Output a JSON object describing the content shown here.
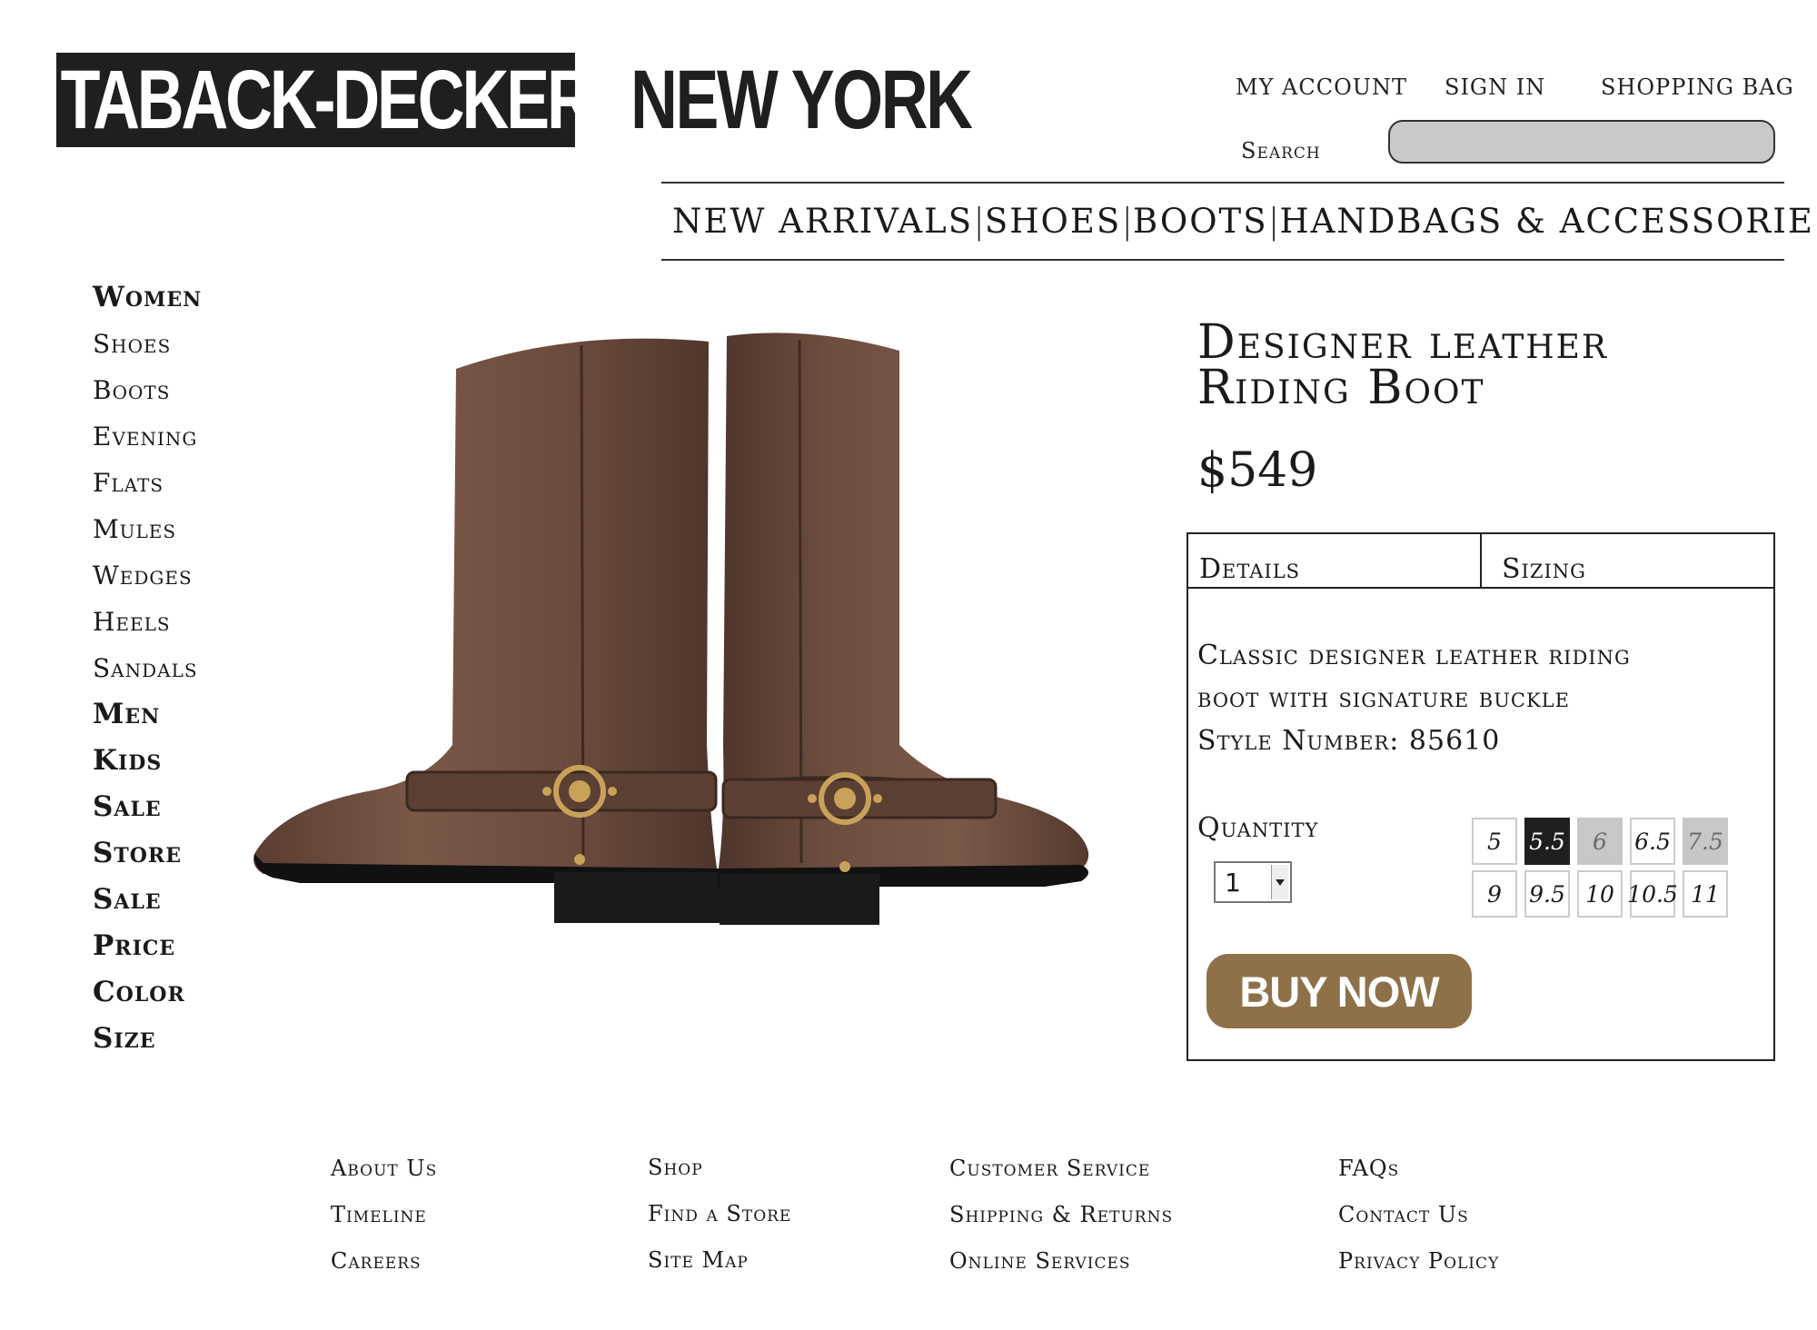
{
  "brand": {
    "logo_dark": "TABACK-DECKER",
    "logo_light": "NEW YORK"
  },
  "header": {
    "my_account": "MY ACCOUNT",
    "sign_in": "SIGN IN",
    "shopping_bag": "SHOPPING BAG",
    "search_label": "Search",
    "search_value": ""
  },
  "nav": {
    "items": [
      "NEW ARRIVALS",
      "SHOES",
      "BOOTS",
      "HANDBAGS & ACCESSORIES"
    ],
    "separator": "|"
  },
  "sidebar": {
    "items": [
      {
        "label": "Women",
        "main": true
      },
      {
        "label": "Shoes",
        "main": false
      },
      {
        "label": "Boots",
        "main": false
      },
      {
        "label": "Evening",
        "main": false
      },
      {
        "label": "Flats",
        "main": false
      },
      {
        "label": "Mules",
        "main": false
      },
      {
        "label": "Wedges",
        "main": false
      },
      {
        "label": "Heels",
        "main": false
      },
      {
        "label": "Sandals",
        "main": false
      },
      {
        "label": "Men",
        "main": true
      },
      {
        "label": "Kids",
        "main": true
      },
      {
        "label": "Sale",
        "main": true
      },
      {
        "label": "Store",
        "main": true
      },
      {
        "label": "Sale",
        "main": true
      },
      {
        "label": "Price",
        "main": true
      },
      {
        "label": "Color",
        "main": true
      },
      {
        "label": "Size",
        "main": true
      }
    ]
  },
  "product": {
    "title_line1": "Designer leather",
    "title_line2": "Riding Boot",
    "price": "$549",
    "tabs": {
      "details": "Details",
      "sizing": "Sizing"
    },
    "desc_line1": "Classic designer leather riding",
    "desc_line2": "boot with signature buckle",
    "style_number": "Style Number: 85610",
    "quantity_label": "Quantity",
    "quantity_value": "1",
    "sizes": [
      {
        "label": "5",
        "state": "available"
      },
      {
        "label": "5.5",
        "state": "selected"
      },
      {
        "label": "6",
        "state": "unavailable"
      },
      {
        "label": "6.5",
        "state": "available"
      },
      {
        "label": "7.5",
        "state": "unavailable"
      },
      {
        "label": "9",
        "state": "available"
      },
      {
        "label": "9.5",
        "state": "available"
      },
      {
        "label": "10",
        "state": "available"
      },
      {
        "label": "10.5",
        "state": "available"
      },
      {
        "label": "11",
        "state": "available"
      }
    ],
    "buy_label": "BUY NOW",
    "image_icon": "riding-boots-photo"
  },
  "colors": {
    "buy_button": "#8f7149",
    "selected_size": "#1f1f1f",
    "unavailable_size": "#c7c7c5",
    "search_field": "#c9c9c9",
    "boot_leather": "#6e4d3f"
  },
  "footer": {
    "columns": [
      [
        "About Us",
        "Timeline",
        "Careers"
      ],
      [
        "Shop",
        "Find a Store",
        "Site Map"
      ],
      [
        "Customer Service",
        "Shipping & Returns",
        "Online Services"
      ],
      [
        "FAQs",
        "Contact Us",
        "Privacy Policy"
      ]
    ]
  }
}
